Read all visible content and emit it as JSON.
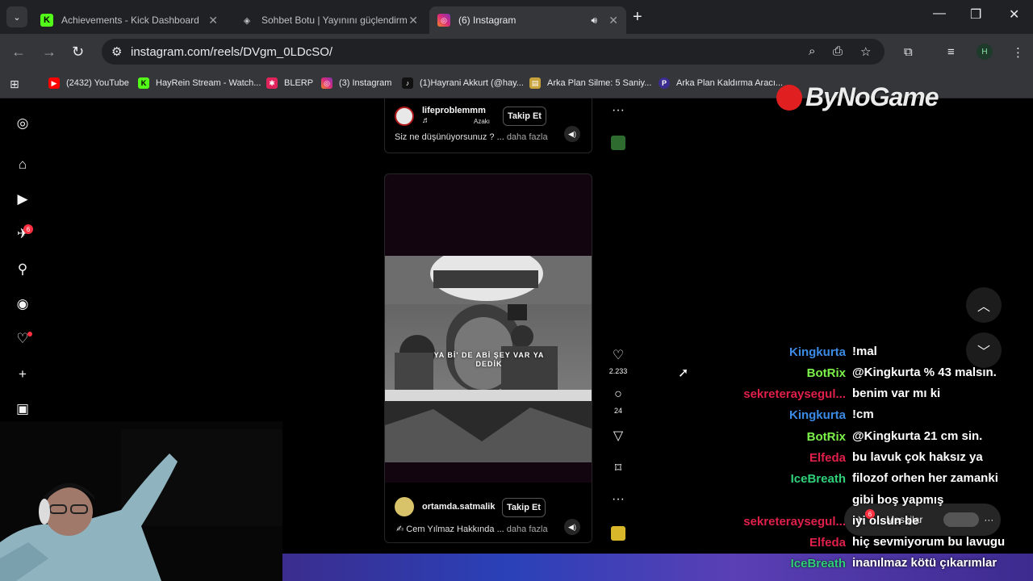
{
  "tabs": [
    {
      "title": "Achievements - Kick Dashboard",
      "favicon": "kick-icon"
    },
    {
      "title": "Sohbet Botu | Yayınını güçlendirmek i",
      "favicon": "bot-icon"
    },
    {
      "title": "(6) Instagram",
      "favicon": "instagram-icon"
    }
  ],
  "address": {
    "url": "instagram.com/reels/DVgm_0LDcSO/"
  },
  "profile_initial": "H",
  "bookmarks": [
    "(2432) YouTube",
    "HayRein Stream - Watch...",
    "BLERP",
    "(3) Instagram",
    "(1)Hayrani Akkurt (@hay...",
    "Arka Plan Silme: 5 Saniy...",
    "Arka Plan Kaldırma Aracı..."
  ],
  "sidebar": {
    "notification_count": "6"
  },
  "reel1": {
    "username": "lifeproblemmm",
    "audio": "Azakı",
    "follow_label": "Takip Et",
    "caption": "Siz ne düşünüyorsunuz ? ...",
    "more_label": "daha fazla"
  },
  "reel2": {
    "username": "ortamda.satmalik",
    "follow_label": "Takip Et",
    "caption": "Cem Yılmaz Hakkında ...",
    "more_label": "daha fazla",
    "video_subtitle_1": "YA Bİ' DE ABİ ŞEY VAR YA",
    "video_subtitle_2": "DEDİK",
    "likes": "2.233",
    "comments": "24"
  },
  "messages": {
    "label": "Mesajlar",
    "count": "6"
  },
  "brand_overlay": "ByNoGame",
  "chat": [
    {
      "user": "Kingkurta",
      "color": "#3b8be6",
      "msg": "!mal"
    },
    {
      "user": "BotRix",
      "color": "#7cf24a",
      "msg": "@Kingkurta % 43 malsın."
    },
    {
      "user": "sekreteraysegul...",
      "color": "#e0204a",
      "msg": "benim var mı ki"
    },
    {
      "user": "Kingkurta",
      "color": "#3b8be6",
      "msg": "!cm"
    },
    {
      "user": "BotRix",
      "color": "#7cf24a",
      "msg": "@Kingkurta 21 cm sin."
    },
    {
      "user": "Elfeda",
      "color": "#e0204a",
      "msg": "bu lavuk çok haksız ya"
    },
    {
      "user": "IceBreath",
      "color": "#2fd07a",
      "msg": "filozof orhen her zamanki gibi boş yapmış"
    },
    {
      "user": "sekreteraysegul...",
      "color": "#e0204a",
      "msg": "iyi olsun be"
    },
    {
      "user": "Elfeda",
      "color": "#e0204a",
      "msg": "hiç sevmiyorum bu lavugu"
    },
    {
      "user": "IceBreath",
      "color": "#2fd07a",
      "msg": "inanılmaz kötü çıkarımlar"
    }
  ]
}
